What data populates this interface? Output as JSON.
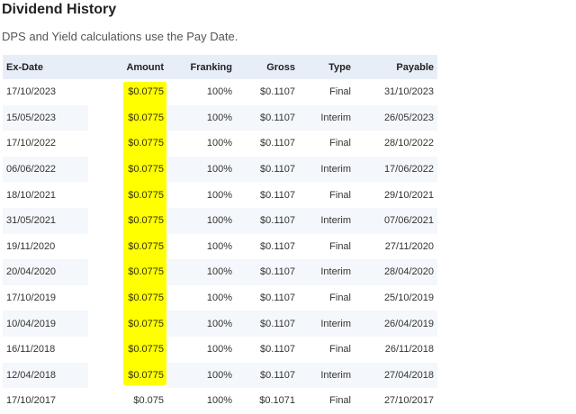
{
  "header": {
    "title": "Dividend History",
    "subtitle": "DPS and Yield calculations use the Pay Date."
  },
  "table": {
    "columns": [
      "Ex-Date",
      "Amount",
      "Franking",
      "Gross",
      "Type",
      "Payable"
    ],
    "rows": [
      {
        "ex_date": "17/10/2023",
        "amount": "$0.0775",
        "franking": "100%",
        "gross": "$0.1107",
        "type": "Final",
        "payable": "31/10/2023",
        "highlighted": true
      },
      {
        "ex_date": "15/05/2023",
        "amount": "$0.0775",
        "franking": "100%",
        "gross": "$0.1107",
        "type": "Interim",
        "payable": "26/05/2023",
        "highlighted": true
      },
      {
        "ex_date": "17/10/2022",
        "amount": "$0.0775",
        "franking": "100%",
        "gross": "$0.1107",
        "type": "Final",
        "payable": "28/10/2022",
        "highlighted": true
      },
      {
        "ex_date": "06/06/2022",
        "amount": "$0.0775",
        "franking": "100%",
        "gross": "$0.1107",
        "type": "Interim",
        "payable": "17/06/2022",
        "highlighted": true
      },
      {
        "ex_date": "18/10/2021",
        "amount": "$0.0775",
        "franking": "100%",
        "gross": "$0.1107",
        "type": "Final",
        "payable": "29/10/2021",
        "highlighted": true
      },
      {
        "ex_date": "31/05/2021",
        "amount": "$0.0775",
        "franking": "100%",
        "gross": "$0.1107",
        "type": "Interim",
        "payable": "07/06/2021",
        "highlighted": true
      },
      {
        "ex_date": "19/11/2020",
        "amount": "$0.0775",
        "franking": "100%",
        "gross": "$0.1107",
        "type": "Final",
        "payable": "27/11/2020",
        "highlighted": true
      },
      {
        "ex_date": "20/04/2020",
        "amount": "$0.0775",
        "franking": "100%",
        "gross": "$0.1107",
        "type": "Interim",
        "payable": "28/04/2020",
        "highlighted": true
      },
      {
        "ex_date": "17/10/2019",
        "amount": "$0.0775",
        "franking": "100%",
        "gross": "$0.1107",
        "type": "Final",
        "payable": "25/10/2019",
        "highlighted": true
      },
      {
        "ex_date": "10/04/2019",
        "amount": "$0.0775",
        "franking": "100%",
        "gross": "$0.1107",
        "type": "Interim",
        "payable": "26/04/2019",
        "highlighted": true
      },
      {
        "ex_date": "16/11/2018",
        "amount": "$0.0775",
        "franking": "100%",
        "gross": "$0.1107",
        "type": "Final",
        "payable": "26/11/2018",
        "highlighted": true
      },
      {
        "ex_date": "12/04/2018",
        "amount": "$0.0775",
        "franking": "100%",
        "gross": "$0.1107",
        "type": "Interim",
        "payable": "27/04/2018",
        "highlighted": true
      },
      {
        "ex_date": "17/10/2017",
        "amount": "$0.075",
        "franking": "100%",
        "gross": "$0.1071",
        "type": "Final",
        "payable": "27/10/2017",
        "highlighted": false
      }
    ]
  },
  "colors": {
    "highlight": "#ffff00",
    "header_bg": "#e8eef8",
    "stripe_bg": "#f4f7fb"
  }
}
